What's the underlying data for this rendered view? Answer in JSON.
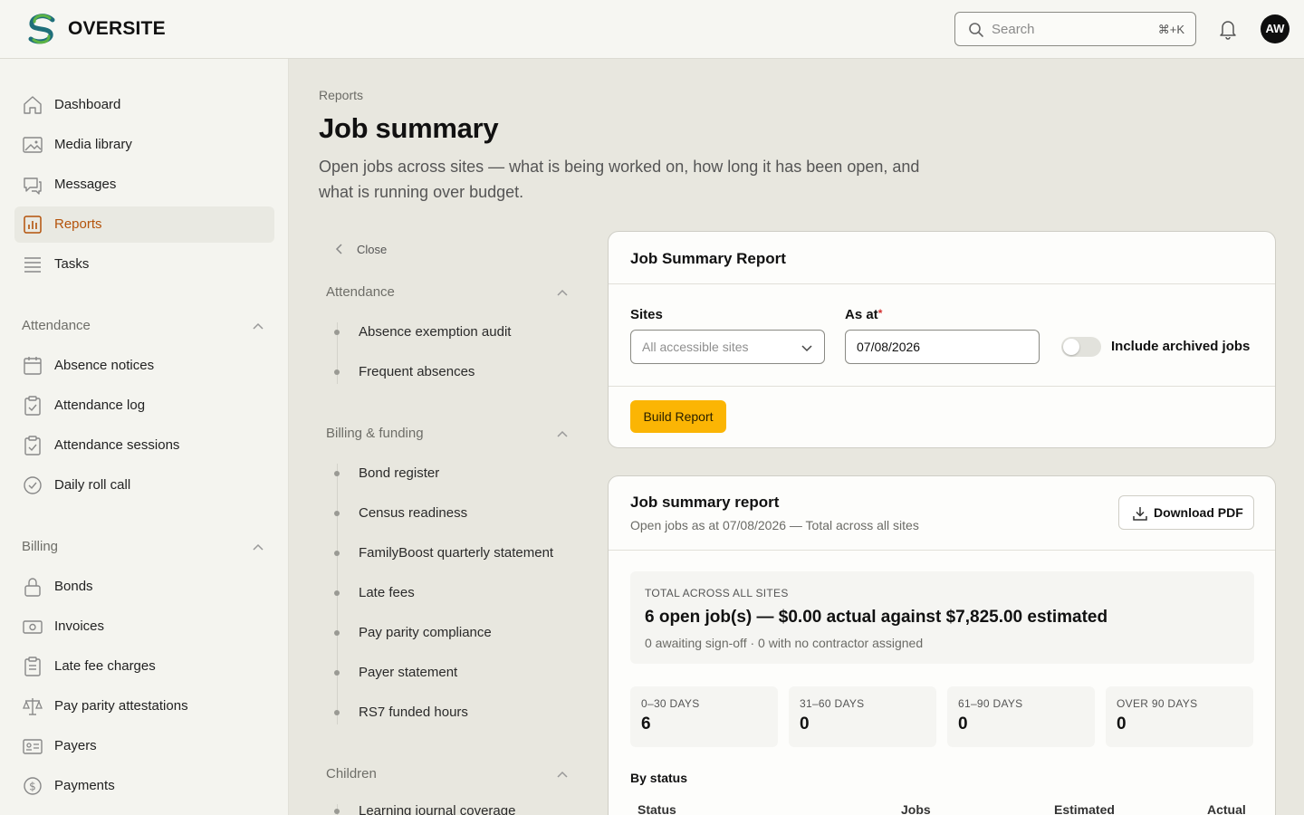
{
  "header": {
    "brand": "OVERSITE",
    "search_placeholder": "Search",
    "search_shortcut": "⌘+K",
    "avatar_initials": "AW"
  },
  "sidebar": {
    "items": [
      {
        "label": "Dashboard",
        "icon": "home-icon"
      },
      {
        "label": "Media library",
        "icon": "image-icon"
      },
      {
        "label": "Messages",
        "icon": "chat-icon"
      },
      {
        "label": "Reports",
        "icon": "chart-icon",
        "active": true
      },
      {
        "label": "Tasks",
        "icon": "list-icon"
      }
    ],
    "attendance": {
      "title": "Attendance",
      "items": [
        "Absence notices",
        "Attendance log",
        "Attendance sessions",
        "Daily roll call"
      ]
    },
    "billing": {
      "title": "Billing",
      "items": [
        "Bonds",
        "Invoices",
        "Late fee charges",
        "Pay parity attestations",
        "Payers",
        "Payments"
      ]
    }
  },
  "page": {
    "breadcrumb": "Reports",
    "title": "Job summary",
    "description": "Open jobs across sites — what is being worked on, how long it has been open, and what is running over budget."
  },
  "subnav": {
    "close_label": "Close",
    "attendance": {
      "title": "Attendance",
      "items": [
        "Absence exemption audit",
        "Frequent absences"
      ]
    },
    "billing": {
      "title": "Billing & funding",
      "items": [
        "Bond register",
        "Census readiness",
        "FamilyBoost quarterly statement",
        "Late fees",
        "Pay parity compliance",
        "Payer statement",
        "RS7 funded hours"
      ]
    },
    "children": {
      "title": "Children",
      "items": [
        "Learning journal coverage"
      ]
    }
  },
  "form": {
    "title": "Job Summary Report",
    "sites_label": "Sites",
    "sites_placeholder": "All accessible sites",
    "as_at_label": "As at",
    "as_at_required": "*",
    "as_at_value": "07/08/2026",
    "archived_label": "Include archived jobs",
    "archived_on": false,
    "build_label": "Build Report"
  },
  "report": {
    "title": "Job summary report",
    "subtitle": "Open jobs as at 07/08/2026 — Total across all sites",
    "download_label": "Download PDF",
    "total_kicker": "TOTAL ACROSS ALL SITES",
    "total_headline": "6 open job(s) — $0.00 actual against $7,825.00 estimated",
    "total_sub": "0 awaiting sign-off · 0 with no contractor assigned",
    "buckets": [
      {
        "label": "0–30 DAYS",
        "value": "6"
      },
      {
        "label": "31–60 DAYS",
        "value": "0"
      },
      {
        "label": "61–90 DAYS",
        "value": "0"
      },
      {
        "label": "OVER 90 DAYS",
        "value": "0"
      }
    ],
    "by_status_label": "By status",
    "columns": [
      "Status",
      "Jobs",
      "Estimated",
      "Actual"
    ]
  },
  "colors": {
    "accent": "#b4530b",
    "button": "#fbb504",
    "logo_green": "#4a9a3a",
    "logo_teal": "#1f6f7a"
  }
}
